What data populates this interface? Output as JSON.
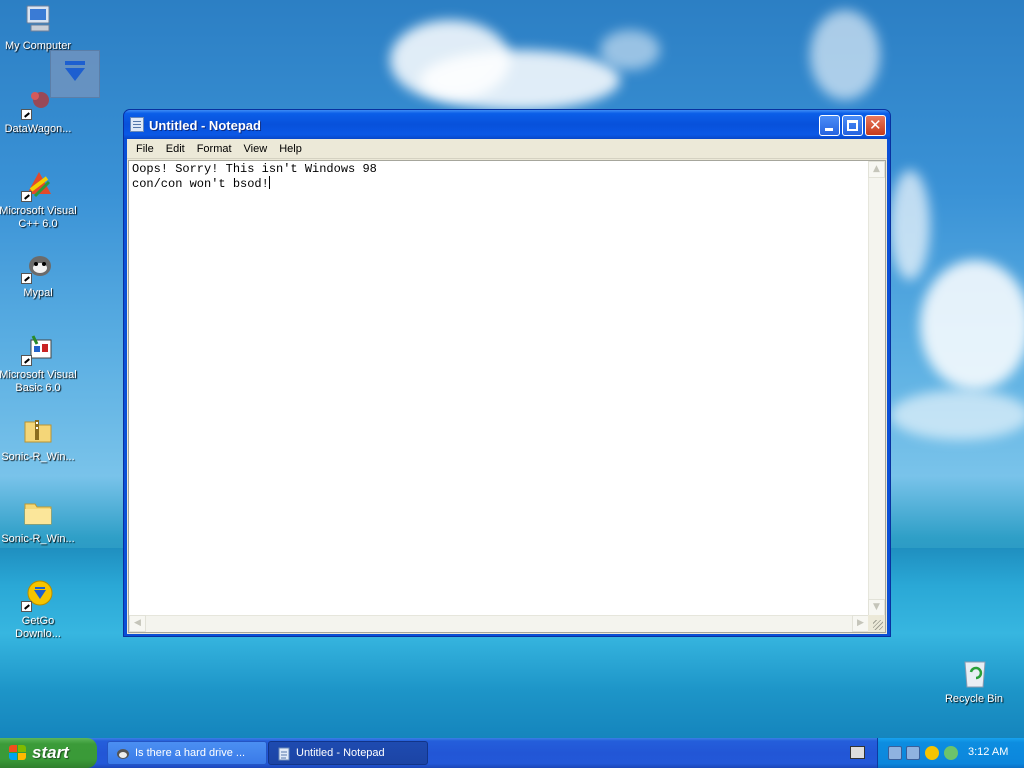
{
  "desktop": {
    "icons": [
      {
        "label": "My Computer",
        "icon": "my-computer-icon"
      },
      {
        "label": "DataWagon...",
        "icon": "datawagon-icon"
      },
      {
        "label": "Microsoft Visual C++ 6.0",
        "icon": "visual-cpp-icon"
      },
      {
        "label": "Mypal",
        "icon": "mypal-icon"
      },
      {
        "label": "Microsoft Visual Basic 6.0",
        "icon": "visual-basic-icon"
      },
      {
        "label": "Sonic-R_Win...",
        "icon": "zip-folder-icon"
      },
      {
        "label": "Sonic-R_Win...",
        "icon": "folder-icon"
      },
      {
        "label": "GetGo Downlo...",
        "icon": "getgo-icon"
      },
      {
        "label": "Recycle Bin",
        "icon": "recycle-bin-icon"
      }
    ]
  },
  "window": {
    "title": "Untitled - Notepad",
    "menu": [
      "File",
      "Edit",
      "Format",
      "View",
      "Help"
    ],
    "content_line1": "Oops! Sorry! This isn't Windows 98",
    "content_line2": "con/con won't bsod!"
  },
  "taskbar": {
    "start_label": "start",
    "tasks": [
      {
        "label": "Is there a hard drive ...",
        "active": false
      },
      {
        "label": "Untitled - Notepad",
        "active": true
      }
    ],
    "clock": "3:12 AM"
  },
  "colors": {
    "title_bar": "#0851db",
    "start_button": "#3a9a38",
    "taskbar": "#2256d6",
    "tray": "#0b86dc"
  }
}
